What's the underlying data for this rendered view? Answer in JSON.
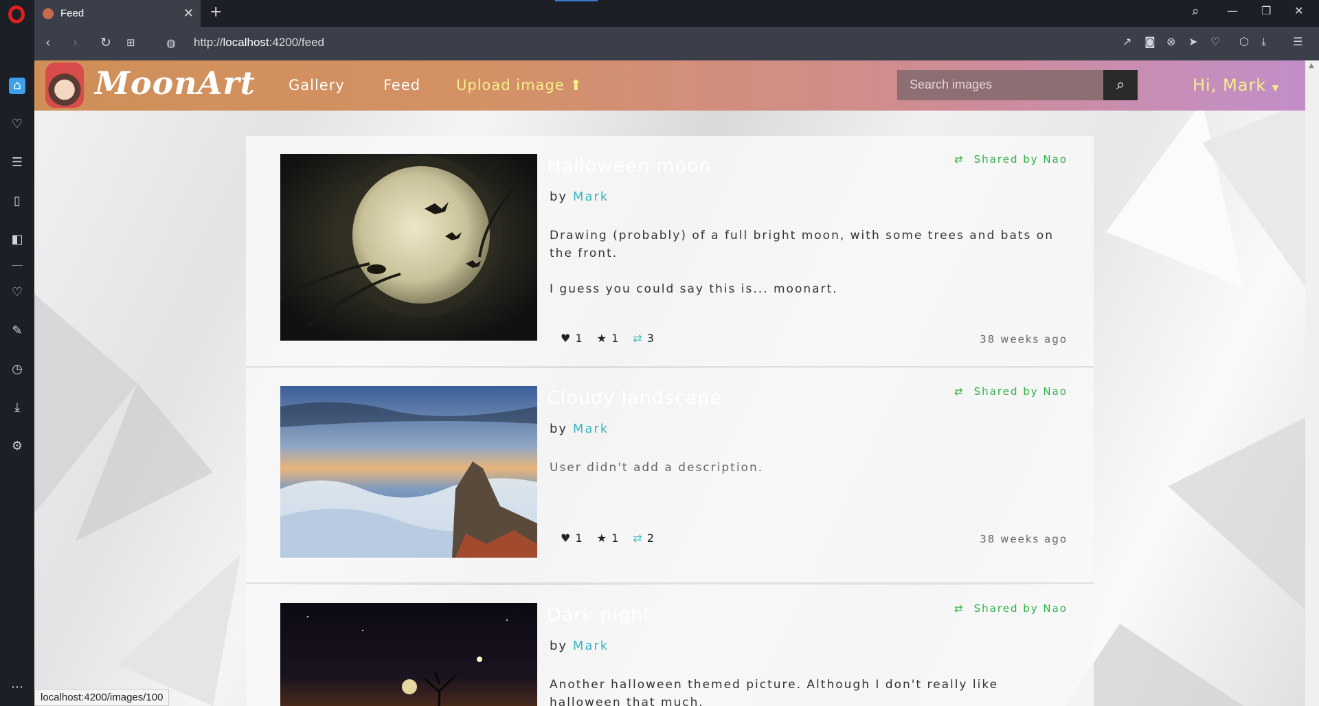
{
  "browser": {
    "tab_title": "Feed",
    "url_prefix": "http://",
    "url_host": "localhost",
    "url_rest": ":4200/feed",
    "status_url": "localhost:4200/images/100"
  },
  "site": {
    "brand": "MoonArt",
    "nav": [
      "Gallery",
      "Feed",
      "Upload image"
    ],
    "search_placeholder": "Search images",
    "greeting": "Hi,",
    "user": "Mark"
  },
  "colors": {
    "accent_green": "#2fb14a",
    "accent_teal": "#3bb6c4",
    "highlight_yellow": "#f6ef8a"
  },
  "posts": [
    {
      "title": "Halloween moon",
      "shared": "Shared by Nao",
      "by": "by",
      "author": "Mark",
      "desc1": "Drawing (probably) of a full bright moon, with some trees and bats on the front.",
      "desc2": "I guess you could say this is... moonart.",
      "likes": "1",
      "stars": "1",
      "reposts": "3",
      "time": "38 weeks ago"
    },
    {
      "title": "Cloudy landscape",
      "shared": "Shared by Nao",
      "by": "by",
      "author": "Mark",
      "desc1": "User didn't add a description.",
      "likes": "1",
      "stars": "1",
      "reposts": "2",
      "time": "38 weeks ago"
    },
    {
      "title": "Dark night",
      "shared": "Shared by Nao",
      "by": "by",
      "author": "Mark",
      "desc1": "Another halloween themed picture. Although I don't really like halloween that much."
    }
  ]
}
